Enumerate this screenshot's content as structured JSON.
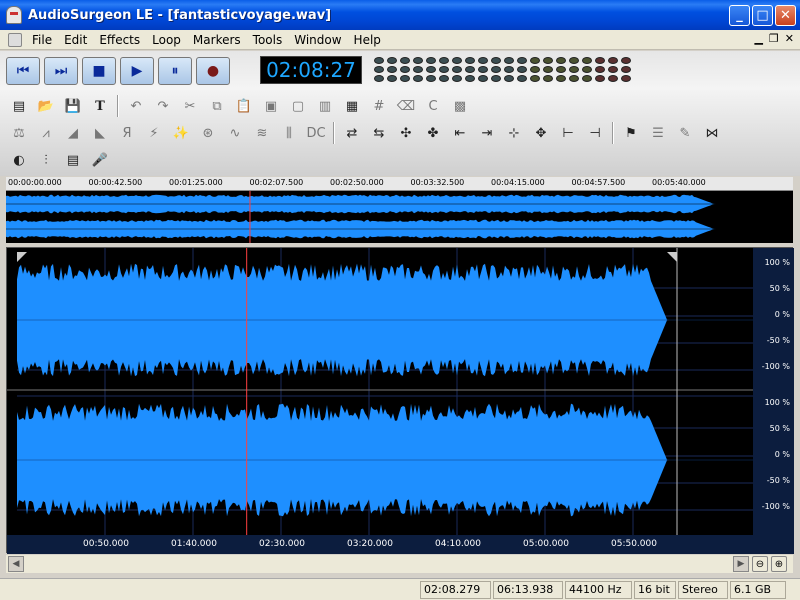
{
  "window": {
    "title": "AudioSurgeon LE - [fantasticvoyage.wav]",
    "icon": "app-mask-icon",
    "controls": {
      "minimize": "_",
      "maximize": "□",
      "close": "✕"
    }
  },
  "menubar": {
    "items": [
      {
        "label": "File"
      },
      {
        "label": "Edit"
      },
      {
        "label": "Effects"
      },
      {
        "label": "Loop"
      },
      {
        "label": "Markers"
      },
      {
        "label": "Tools"
      },
      {
        "label": "Window"
      },
      {
        "label": "Help"
      }
    ]
  },
  "transport": {
    "buttons": [
      "skip-back",
      "skip-forward",
      "stop",
      "play",
      "pause",
      "record"
    ],
    "time": "02:08:27"
  },
  "overview": {
    "ticks": [
      "00:00:00.000",
      "00:00:42.500",
      "00:01:25.000",
      "00:02:07.500",
      "00:02:50.000",
      "00:03:32.500",
      "00:04:15.000",
      "00:04:57.500",
      "00:05:40.000"
    ]
  },
  "waveform": {
    "level_labels": [
      "100 %",
      "50 %",
      "0 %",
      "-50 %",
      "-100 %"
    ],
    "time_labels": [
      "00:50.000",
      "01:40.000",
      "02:30.000",
      "03:20.000",
      "04:10.000",
      "05:00.000",
      "05:50.000"
    ],
    "wave_color": "#1e8fff",
    "cursor_color": "#ff4040",
    "playhead_fraction": 0.348
  },
  "statusbar": {
    "position": "02:08.279",
    "length": "06:13.938",
    "sample_rate": "44100 Hz",
    "bit_depth": "16 bit",
    "channels": "Stereo",
    "free_space": "6.1 GB"
  }
}
